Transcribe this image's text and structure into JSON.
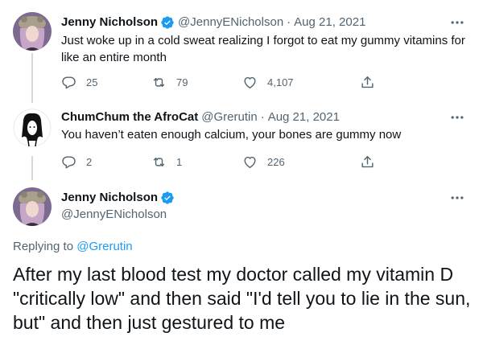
{
  "tweets": [
    {
      "name": "Jenny Nicholson",
      "handle": "@JennyENicholson",
      "separator": "·",
      "date": "Aug 21, 2021",
      "text": "Just woke up in a cold sweat realizing I forgot to eat my gummy vitamins for like an entire month",
      "verified": true,
      "replies": "25",
      "retweets": "79",
      "likes": "4,107"
    },
    {
      "name": "ChumChum the AfroCat",
      "handle": "@Grerutin",
      "separator": "·",
      "date": "Aug 21, 2021",
      "text": "You haven’t eaten enough calcium, your bones are gummy now",
      "verified": false,
      "replies": "2",
      "retweets": "1",
      "likes": "226"
    }
  ],
  "main_tweet": {
    "name": "Jenny Nicholson",
    "handle": "@JennyENicholson",
    "verified": true,
    "replying_prefix": "Replying to",
    "replying_to": "@Grerutin",
    "text": "After my last blood test my doctor called my vitamin D \"critically low\" and then said \"I'd tell you to lie in the sun, but\" and then just gestured to me"
  },
  "icons": {
    "reply": "reply-icon",
    "retweet": "retweet-icon",
    "like": "heart-icon",
    "share": "share-icon",
    "more": "more-icon",
    "verified": "verified-badge-icon"
  },
  "colors": {
    "accent": "#1d9bf0",
    "text": "#0f1419",
    "secondary": "#536471",
    "thread_line": "#cfd9de"
  }
}
